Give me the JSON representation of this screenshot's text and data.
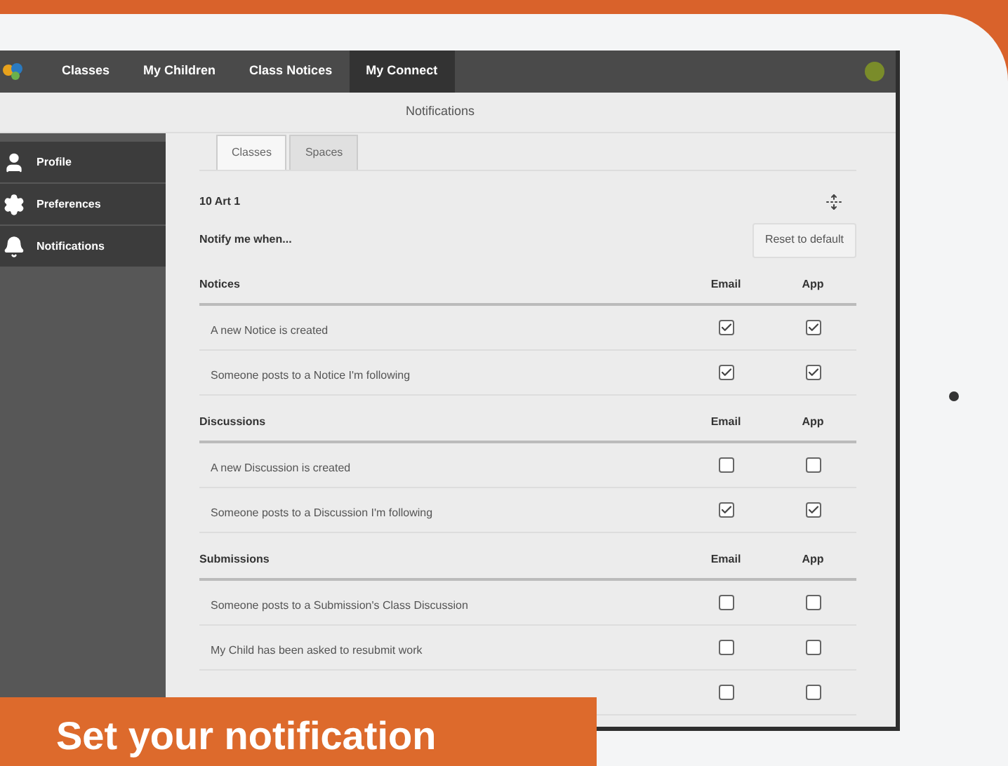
{
  "nav": {
    "items": [
      {
        "label": "Classes",
        "selected": false
      },
      {
        "label": "My Children",
        "selected": false
      },
      {
        "label": "Class Notices",
        "selected": false
      },
      {
        "label": "My Connect",
        "selected": true
      }
    ]
  },
  "page_title": "Notifications",
  "sidebar": {
    "items": [
      {
        "label": "Profile",
        "kind": "user"
      },
      {
        "label": "Preferences",
        "kind": "gear"
      },
      {
        "label": "Notifications",
        "kind": "bell"
      }
    ]
  },
  "tabs": [
    {
      "label": "Classes",
      "selected": true
    },
    {
      "label": "Spaces",
      "selected": false
    }
  ],
  "class_name": "10 Art 1",
  "notify_label": "Notify me when...",
  "reset_button": "Reset to default",
  "sections": [
    {
      "title": "Notices",
      "columns": [
        "Email",
        "App"
      ],
      "rows": [
        {
          "label": "A new Notice is created",
          "email": true,
          "app": true
        },
        {
          "label": "Someone posts to a Notice I'm following",
          "email": true,
          "app": true
        }
      ]
    },
    {
      "title": "Discussions",
      "columns": [
        "Email",
        "App"
      ],
      "rows": [
        {
          "label": "A new Discussion is created",
          "email": false,
          "app": false
        },
        {
          "label": "Someone posts to a Discussion I'm following",
          "email": true,
          "app": true
        }
      ]
    },
    {
      "title": "Submissions",
      "columns": [
        "Email",
        "App"
      ],
      "rows": [
        {
          "label": "Someone posts to a Submission's Class Discussion",
          "email": false,
          "app": false
        },
        {
          "label": "My Child has been asked to resubmit work",
          "email": false,
          "app": false
        },
        {
          "email": false,
          "app": false
        }
      ]
    }
  ],
  "banner": "Set your notification"
}
